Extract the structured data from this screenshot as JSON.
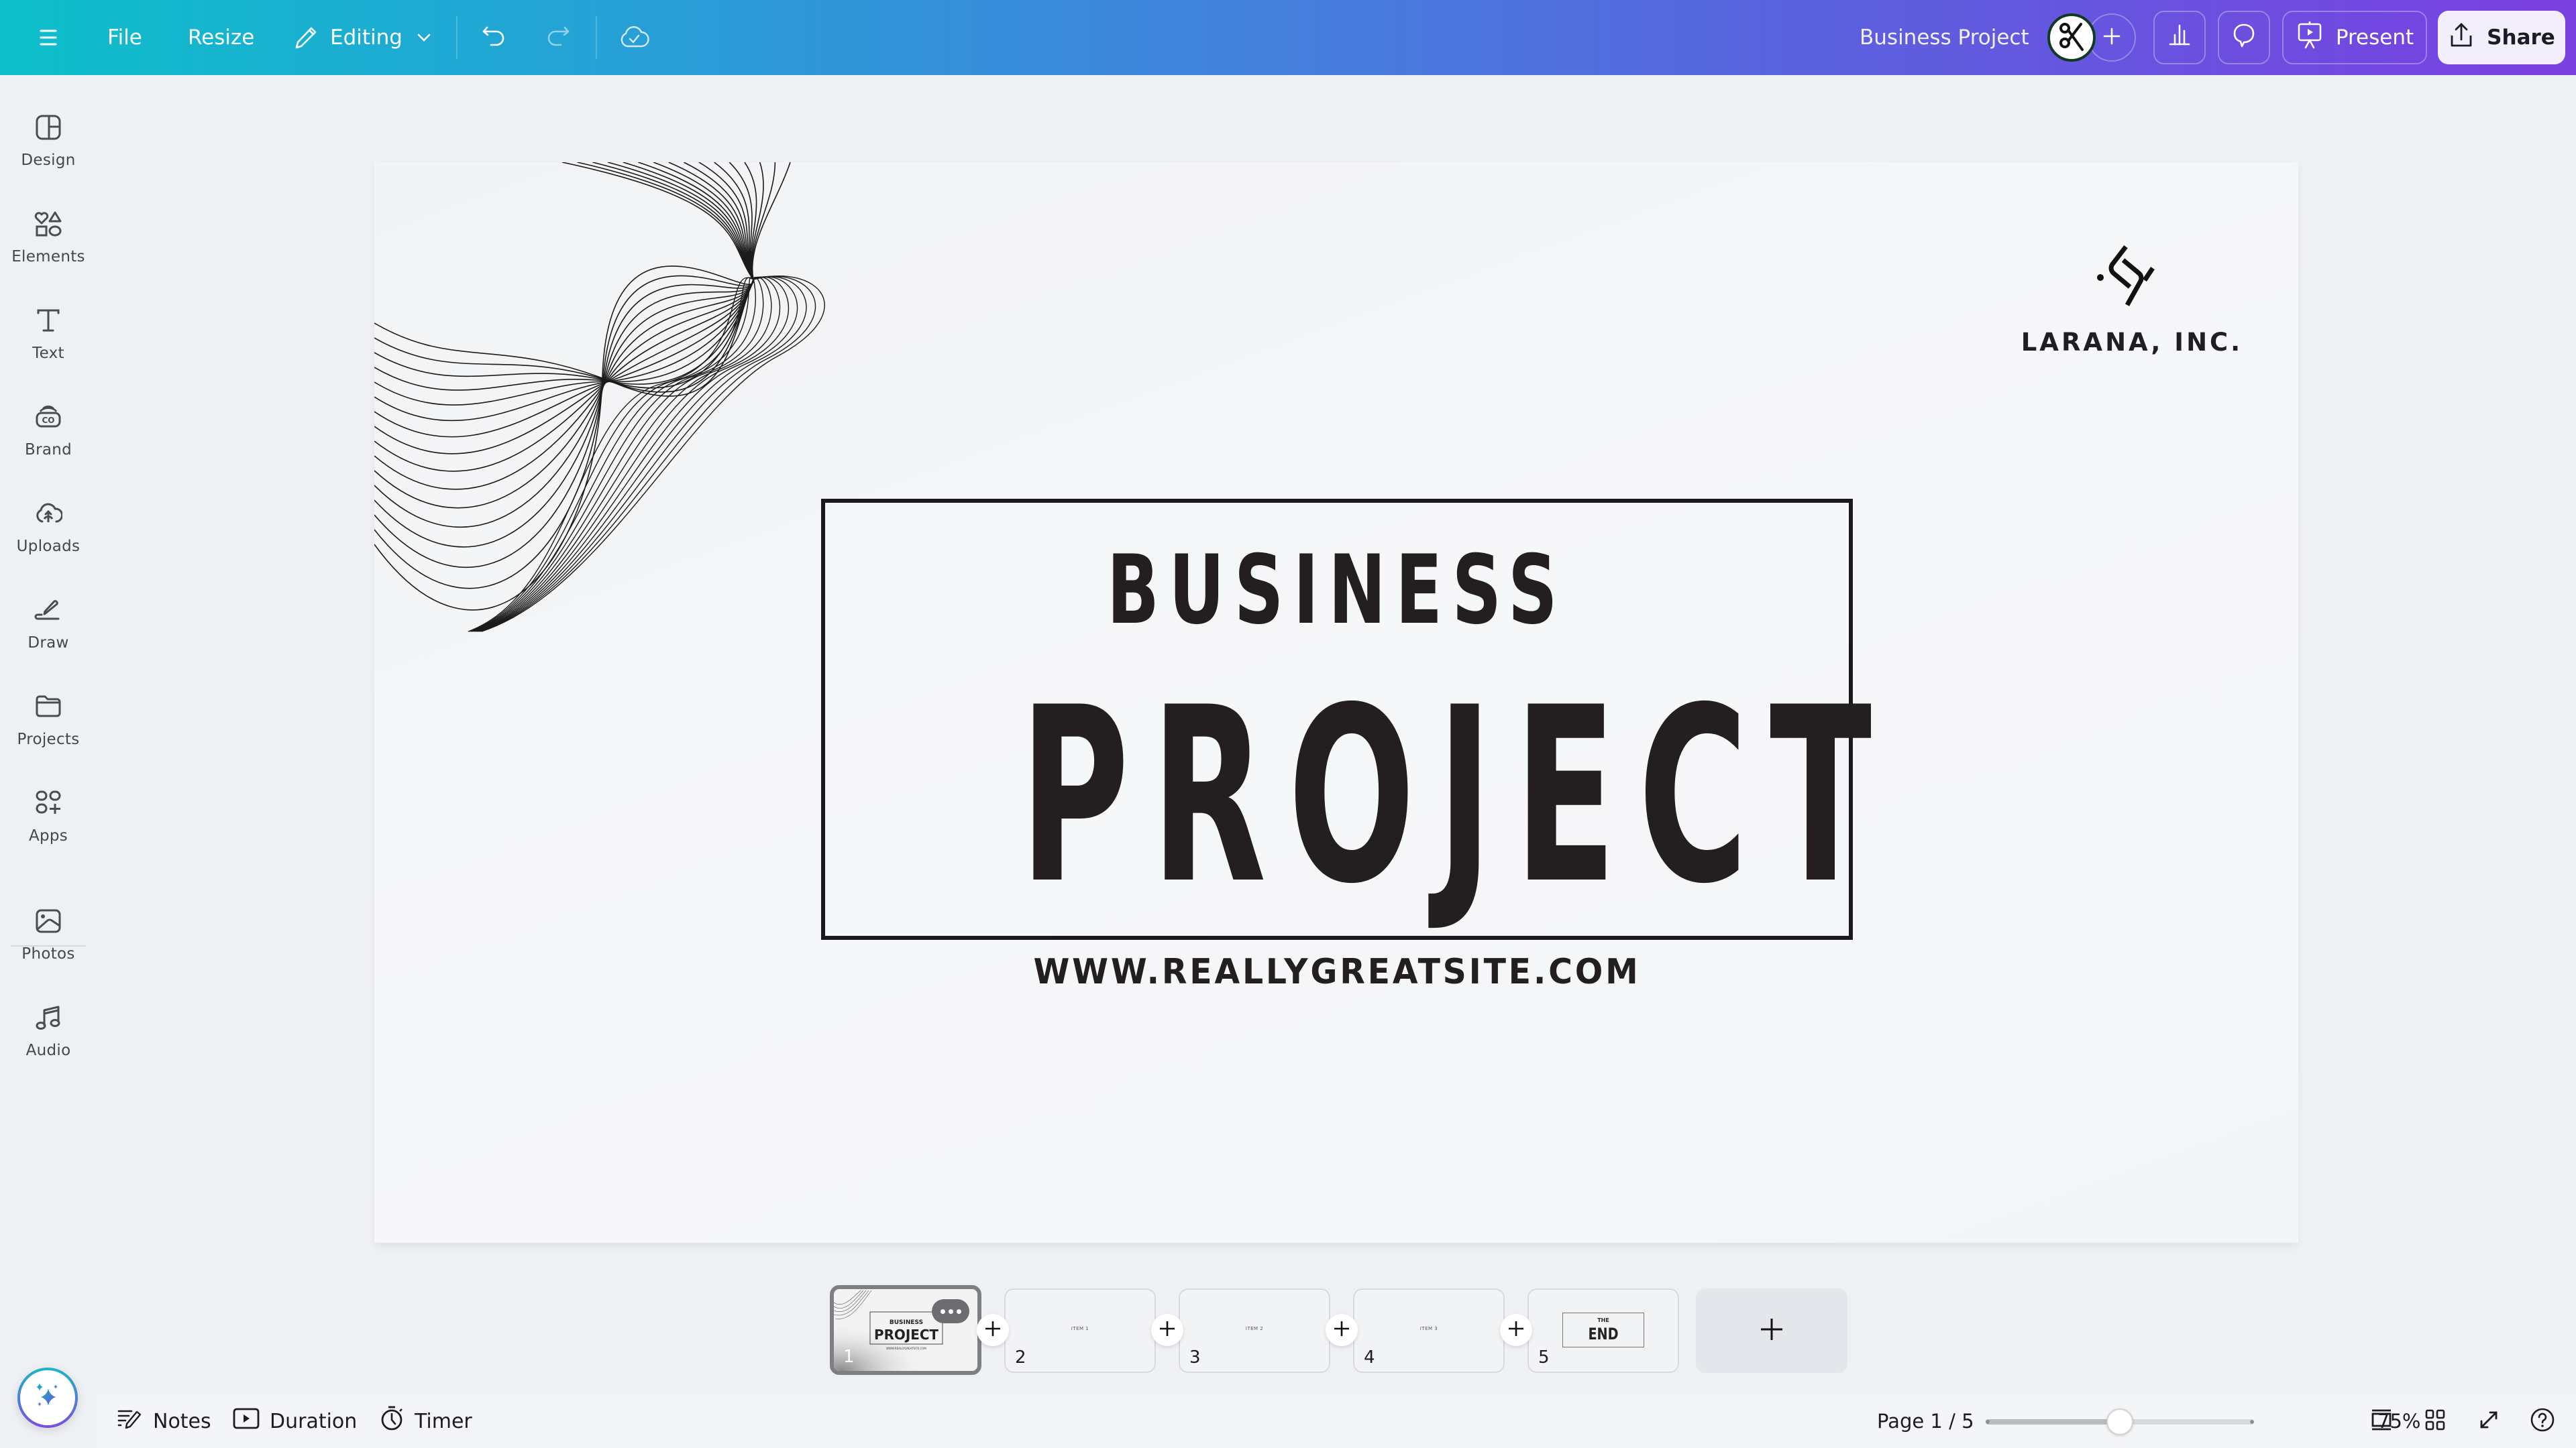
{
  "topbar": {
    "menu_icon": "hamburger-menu-icon",
    "file_label": "File",
    "resize_label": "Resize",
    "editing_label": "Editing",
    "undo_icon": "undo-icon",
    "redo_icon": "redo-icon",
    "save_status_icon": "cloud-check-icon",
    "document_title": "Business Project",
    "avatar_icon": "scissors-avatar-icon",
    "add_collaborator_icon": "plus-icon",
    "insights_icon": "bar-chart-icon",
    "comments_icon": "comment-icon",
    "present_label": "Present",
    "share_label": "Share"
  },
  "rail": {
    "items": [
      {
        "label": "Design",
        "icon": "layout-icon"
      },
      {
        "label": "Elements",
        "icon": "shapes-icon"
      },
      {
        "label": "Text",
        "icon": "text-icon"
      },
      {
        "label": "Brand",
        "icon": "brand-icon"
      },
      {
        "label": "Uploads",
        "icon": "cloud-upload-icon"
      },
      {
        "label": "Draw",
        "icon": "pen-icon"
      },
      {
        "label": "Projects",
        "icon": "folder-icon"
      },
      {
        "label": "Apps",
        "icon": "apps-icon"
      },
      {
        "label": "Photos",
        "icon": "image-icon"
      },
      {
        "label": "Audio",
        "icon": "music-note-icon"
      }
    ],
    "magic_icon": "sparkle-icon"
  },
  "slide": {
    "logo_name": "LARANA, INC.",
    "title_line1": "BUSINESS",
    "title_line2": "PROJECT",
    "website": "WWW.REALLYGREATSITE.COM"
  },
  "pages": {
    "thumbnails": [
      {
        "number": "1",
        "content": "BUSINESS PROJECT",
        "active": true
      },
      {
        "number": "2",
        "content": "ITEM 1",
        "active": false
      },
      {
        "number": "3",
        "content": "ITEM 2",
        "active": false
      },
      {
        "number": "4",
        "content": "ITEM 3",
        "active": false
      },
      {
        "number": "5",
        "content_top": "THE",
        "content_main": "END",
        "active": false
      }
    ],
    "thumb1_mini": {
      "line1": "BUSINESS",
      "line2": "PROJECT",
      "site": "WWW.REALLYGREATSITE.COM"
    }
  },
  "bottombar": {
    "notes_label": "Notes",
    "duration_label": "Duration",
    "timer_label": "Timer",
    "page_indicator": "Page 1 / 5",
    "zoom_value": "75%",
    "zoom_fraction": 0.5,
    "icons": [
      "single-page-view-icon",
      "grid-view-icon",
      "fullscreen-icon",
      "help-icon"
    ]
  },
  "colors": {
    "gradient_start": "#0dc0c9",
    "gradient_end": "#7b3fe0",
    "text_dark": "#231f20",
    "rail_bg": "#eef0f4"
  }
}
